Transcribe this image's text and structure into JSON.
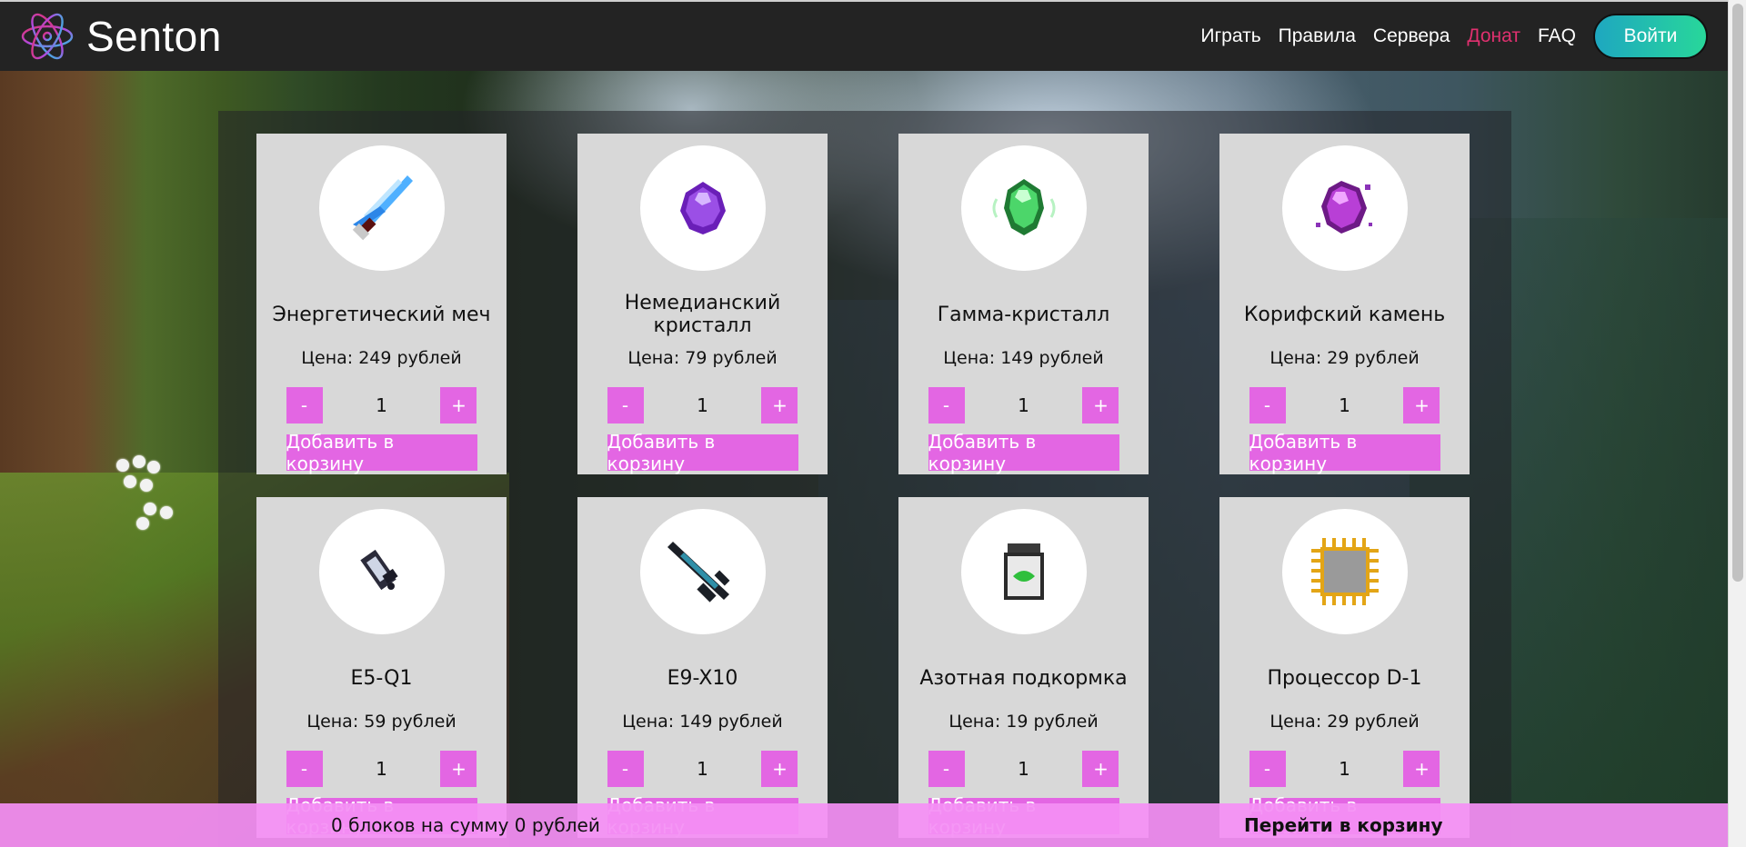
{
  "header": {
    "brand": "Senton",
    "nav": [
      {
        "label": "Играть",
        "active": false
      },
      {
        "label": "Правила",
        "active": false
      },
      {
        "label": "Сервера",
        "active": false
      },
      {
        "label": "Донат",
        "active": true
      },
      {
        "label": "FAQ",
        "active": false
      }
    ],
    "login_label": "Войти",
    "accent_active": "#e0306f"
  },
  "shop": {
    "price_prefix": "Цена:",
    "add_label": "Добавить в корзину",
    "minus_label": "-",
    "plus_label": "+",
    "items": [
      {
        "name": "Энергетический меч",
        "price": "Цена: 249 рублей",
        "qty": "1",
        "icon": "energy-sword-icon"
      },
      {
        "name": "Немедианский кристалл",
        "price": "Цена: 79 рублей",
        "qty": "1",
        "icon": "purple-crystal-icon"
      },
      {
        "name": "Гамма-кристалл",
        "price": "Цена: 149 рублей",
        "qty": "1",
        "icon": "green-crystal-icon"
      },
      {
        "name": "Корифский камень",
        "price": "Цена: 29 рублей",
        "qty": "1",
        "icon": "magenta-stone-icon"
      },
      {
        "name": "E5-Q1",
        "price": "Цена: 59 рублей",
        "qty": "1",
        "icon": "gadget-icon"
      },
      {
        "name": "E9-X10",
        "price": "Цена: 149 рублей",
        "qty": "1",
        "icon": "rifle-icon"
      },
      {
        "name": "Азотная подкормка",
        "price": "Цена: 19 рублей",
        "qty": "1",
        "icon": "fertilizer-jar-icon"
      },
      {
        "name": "Процессор D-1",
        "price": "Цена: 29 рублей",
        "qty": "1",
        "icon": "processor-chip-icon"
      }
    ],
    "button_color": "#e366e3"
  },
  "cart": {
    "summary": "0 блоков на сумму 0 рублей",
    "go_label": "Перейти в корзину"
  }
}
